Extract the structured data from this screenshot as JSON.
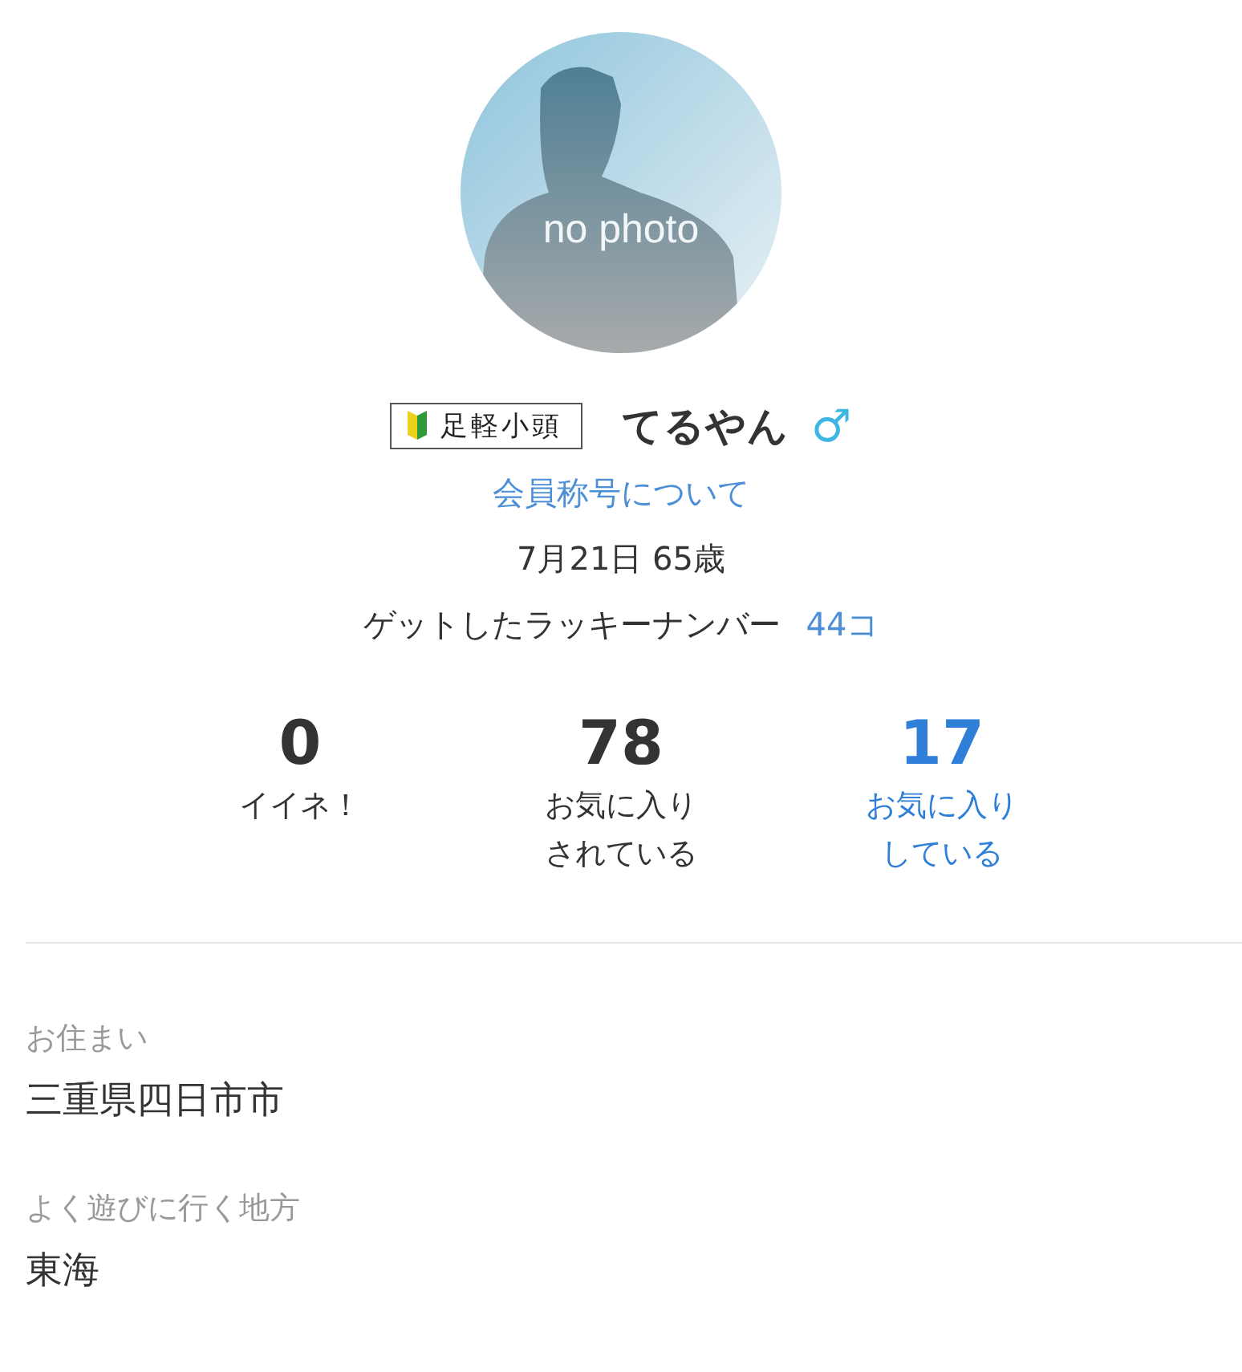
{
  "avatar": {
    "label": "no photo"
  },
  "profile": {
    "rank": "足軽小頭",
    "name": "てるやん",
    "gender_symbol": "♂",
    "rank_link": "会員称号について",
    "birthday": "7月21日 65歳",
    "lucky_label": "ゲットしたラッキーナンバー",
    "lucky_count": "44コ"
  },
  "stats": [
    {
      "value": "0",
      "label": "イイネ！",
      "link": false
    },
    {
      "value": "78",
      "label": "お気に入りされている",
      "link": false
    },
    {
      "value": "17",
      "label": "お気に入りしている",
      "link": true
    }
  ],
  "details": [
    {
      "label": "お住まい",
      "value": "三重県四日市市"
    },
    {
      "label": "よく遊びに行く地方",
      "value": "東海"
    }
  ]
}
